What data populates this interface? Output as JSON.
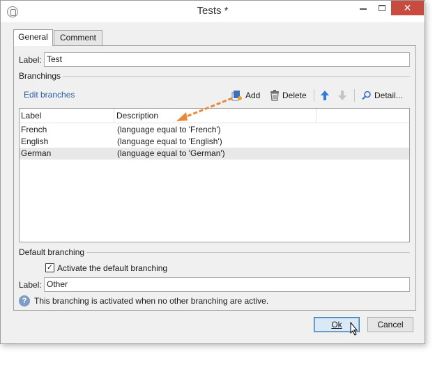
{
  "window": {
    "title": "Tests *",
    "close_glyph": "✕"
  },
  "tabs": [
    {
      "label": "General",
      "active": true
    },
    {
      "label": "Comment",
      "active": false
    }
  ],
  "general": {
    "label_caption": "Label:",
    "label_value": "Test",
    "branchings_title": "Branchings",
    "toolbar": {
      "edit_link": "Edit branches",
      "add": "Add",
      "delete": "Delete",
      "detail": "Detail...",
      "icons": [
        "add-icon",
        "delete-icon",
        "arrow-up-icon",
        "arrow-down-icon",
        "search-icon"
      ]
    },
    "grid": {
      "headers": [
        "Label",
        "Description"
      ],
      "rows": [
        {
          "label": "French",
          "description": "(language equal to 'French')"
        },
        {
          "label": "English",
          "description": "(language equal to 'English')"
        },
        {
          "label": "German",
          "description": "(language equal to 'German')",
          "selected": true
        }
      ]
    },
    "default_branching": {
      "title": "Default branching",
      "checkbox_label": "Activate the default branching",
      "checked": true,
      "check_glyph": "✓",
      "label_caption": "Label:",
      "label_value": "Other",
      "help_text": "This branching is activated when no other branching are active.",
      "help_glyph": "?"
    }
  },
  "buttons": {
    "ok": "Ok",
    "cancel": "Cancel"
  },
  "colors": {
    "link": "#2a5ea8",
    "arrow_annotation": "#e8883a",
    "selected_row": "#e8e8e8",
    "close_button": "#c74b3f"
  }
}
